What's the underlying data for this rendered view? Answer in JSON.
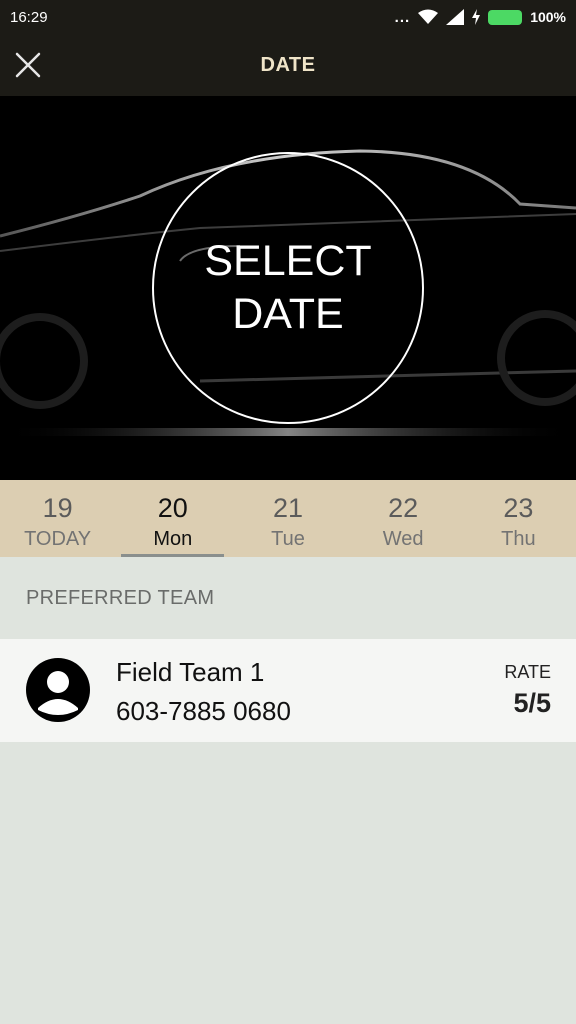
{
  "status_bar": {
    "time": "16:29",
    "dots": "...",
    "battery": "100%",
    "icons": [
      "wifi-icon",
      "signal-icon",
      "charging-icon",
      "battery-icon"
    ]
  },
  "app_bar": {
    "title": "DATE",
    "close_icon": "close-icon"
  },
  "hero": {
    "line1": "SELECT",
    "line2": "DATE"
  },
  "date_strip": {
    "days": [
      {
        "num": "19",
        "label": "TODAY",
        "selected": false
      },
      {
        "num": "20",
        "label": "Mon",
        "selected": true
      },
      {
        "num": "21",
        "label": "Tue",
        "selected": false
      },
      {
        "num": "22",
        "label": "Wed",
        "selected": false
      },
      {
        "num": "23",
        "label": "Thu",
        "selected": false
      }
    ]
  },
  "section": {
    "title": "PREFERRED TEAM"
  },
  "team": {
    "name": "Field Team 1",
    "phone": "603-7885 0680",
    "rate_label": "RATE",
    "rate_value": "5/5",
    "avatar_icon": "person-avatar-icon"
  },
  "colors": {
    "app_bar": "#1c1b16",
    "title": "#efe4c8",
    "date_strip": "#dcceb2",
    "background": "#dfe4de",
    "row": "#f5f6f4",
    "battery": "#4cd964"
  }
}
